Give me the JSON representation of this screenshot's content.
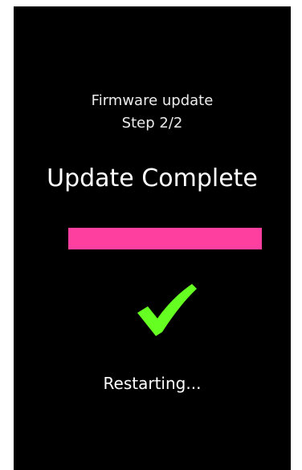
{
  "firmware": {
    "title": "Firmware update",
    "step": "Step 2/2"
  },
  "headline": "Update Complete",
  "progress": {
    "fraction": 1.0,
    "color": "#ff3fa0"
  },
  "success_icon": {
    "name": "checkmark-icon",
    "color": "#66ff22"
  },
  "status": "Restarting..."
}
